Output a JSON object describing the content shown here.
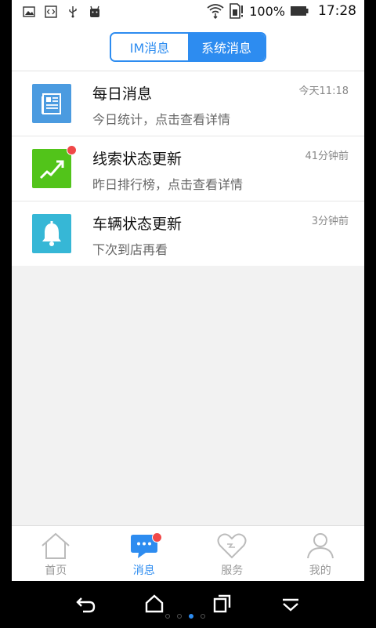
{
  "status_bar": {
    "battery": "100%",
    "time": "17:28",
    "left_icons": [
      "image-icon",
      "code-icon",
      "usb-icon",
      "android-icon"
    ],
    "right_icons": [
      "wifi-icon",
      "sim-alert-icon",
      "battery-icon"
    ]
  },
  "header": {
    "tabs": [
      {
        "label": "IM消息",
        "active": false
      },
      {
        "label": "系统消息",
        "active": true
      }
    ]
  },
  "messages": [
    {
      "title": "每日消息",
      "subtitle": "今日统计，点击查看详情",
      "time": "今天11:18",
      "icon": "newspaper-icon",
      "color": "#4b9be0",
      "unread": false
    },
    {
      "title": "线索状态更新",
      "subtitle": "昨日排行榜，点击查看详情",
      "time": "41分钟前",
      "icon": "trend-up-icon",
      "color": "#52c41a",
      "unread": true
    },
    {
      "title": "车辆状态更新",
      "subtitle": "下次到店再看",
      "time": "3分钟前",
      "icon": "bell-icon",
      "color": "#36b7d6",
      "unread": false
    }
  ],
  "bottom_nav": [
    {
      "label": "首页",
      "icon": "home-icon",
      "active": false
    },
    {
      "label": "消息",
      "icon": "chat-bubble-icon",
      "active": true,
      "badge": true
    },
    {
      "label": "服务",
      "icon": "heart-icon",
      "active": false
    },
    {
      "label": "我的",
      "icon": "user-icon",
      "active": false
    }
  ],
  "system_nav": [
    "back-icon",
    "home-icon",
    "recents-icon",
    "dropdown-icon"
  ],
  "page_indicator": {
    "count": 4,
    "active": 3
  },
  "accent": "#2d8cf0"
}
